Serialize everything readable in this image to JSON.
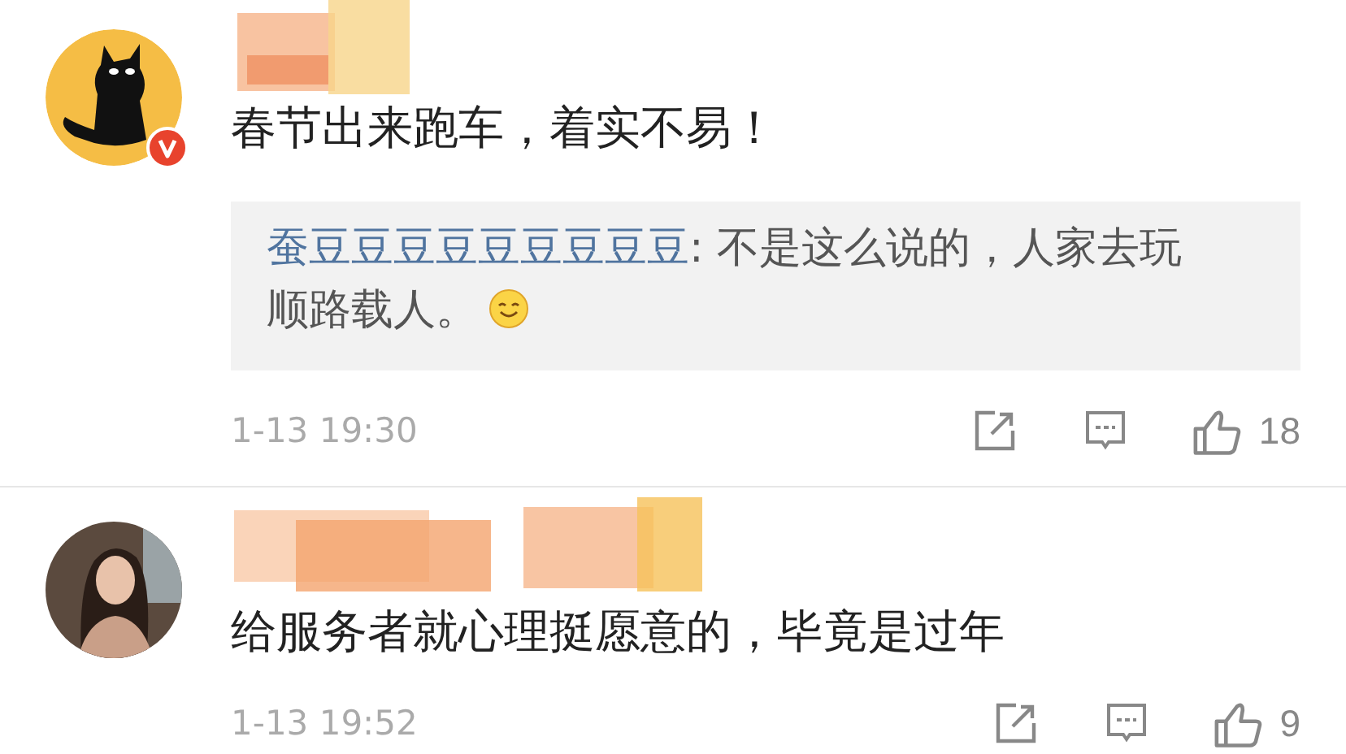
{
  "comments": [
    {
      "avatar": {
        "kind": "cat",
        "verified": true
      },
      "name_hidden": true,
      "text": "春节出来跑车，着实不易！",
      "reply": {
        "user": "蚕豆豆豆豆豆豆豆豆豆",
        "text": ": 不是这么说的，人家去玩顺路载人。",
        "emoji": true
      },
      "time": "1-13 19:30",
      "likes": "18"
    },
    {
      "name_hidden": true,
      "text": "给服务者就心理挺愿意的，毕竟是过年",
      "time": "1-13 19:52",
      "likes": "9"
    }
  ]
}
